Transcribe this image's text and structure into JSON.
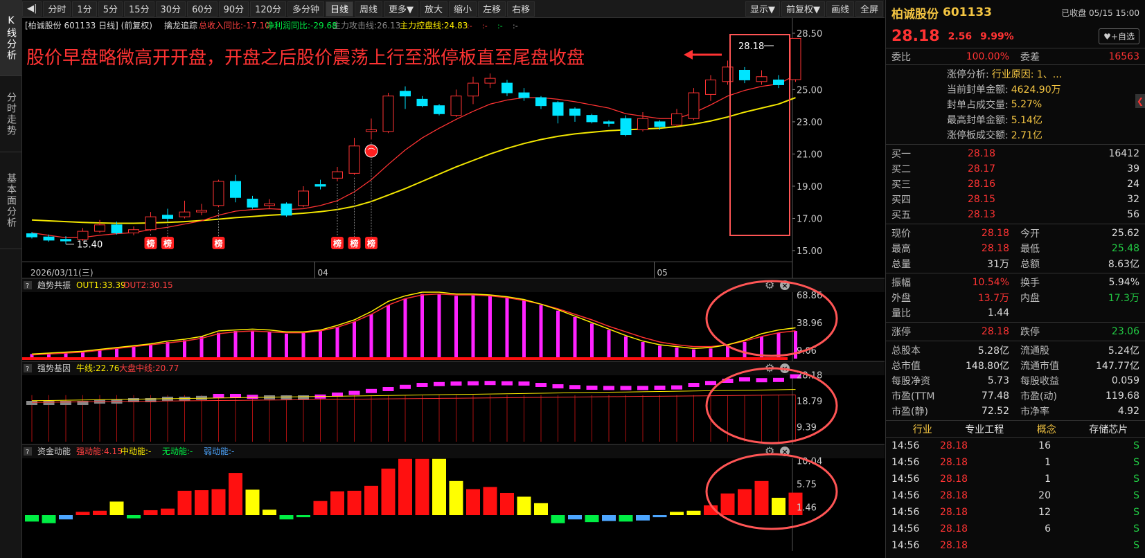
{
  "tabs": [
    "K线分析",
    "分时走势",
    "基本面分析"
  ],
  "toolbar": {
    "left": [
      "◀|",
      "分时",
      "1分",
      "5分",
      "15分",
      "30分",
      "60分",
      "90分",
      "120分",
      "多分钟",
      "日线",
      "周线",
      "更多▼",
      "放大",
      "缩小",
      "左移",
      "右移"
    ],
    "right": [
      "显示▼",
      "前复权▼",
      "画线",
      "全屏"
    ],
    "active": "日线"
  },
  "main": {
    "header": "[柏诚股份 601133 日线] (前复权)",
    "indicator": "擒龙追踪",
    "metrics": [
      "总收入同比:-17.10",
      "净利润同比:-29.68",
      "主力攻击线:26.13",
      "主力控盘线:24.83"
    ],
    "extra": [
      ":-",
      ":-",
      ":-",
      ":-"
    ],
    "annotation": "股价早盘略微高开开盘，开盘之后股价震荡上行至涨停板直至尾盘收盘",
    "price_label": "28.18",
    "low_label": "15.40",
    "date_start": "2026/03/11(三)",
    "months": [
      "04",
      "05"
    ],
    "yticks": [
      "28.50",
      "25.00",
      "23.00",
      "21.00",
      "19.00",
      "17.00",
      "15.00"
    ],
    "bang": "榜"
  },
  "ind1": {
    "name": "趋势共振",
    "out1": "OUT1:33.39",
    "out2": "OUT2:30.15",
    "yticks": [
      "68.86",
      "38.96",
      "9.06"
    ]
  },
  "ind2": {
    "name": "强势基因",
    "a": "牛线:22.76",
    "b": "大盘中线:20.77",
    "yticks": [
      "28.18",
      "18.79",
      "9.39"
    ]
  },
  "ind3": {
    "name": "资金动能",
    "a": "强动能:4.15",
    "b": "中动能:-",
    "c": "无动能:-",
    "d": "弱动能:-",
    "yticks": [
      "10.04",
      "5.75",
      "1.46"
    ]
  },
  "panel": {
    "name": "柏诚股份",
    "code": "601133",
    "status": "已收盘 05/15 15:00",
    "price": "28.18",
    "change": "2.56",
    "pct": "9.99%",
    "fav": "♥+自选",
    "weibi_l": "委比",
    "weibi": "100.00%",
    "weicha_l": "委差",
    "weicha": "16563",
    "zt": [
      {
        "l": "涨停分析:",
        "v": "行业原因: 1、..."
      },
      {
        "l": "当前封单金额:",
        "v": "4624.90万"
      },
      {
        "l": "封单占成交量:",
        "v": "5.27%"
      },
      {
        "l": "最高封单金额:",
        "v": "5.14亿"
      },
      {
        "l": "涨停板成交额:",
        "v": "2.71亿"
      }
    ],
    "bids": [
      {
        "l": "买一",
        "p": "28.18",
        "q": "16412"
      },
      {
        "l": "买二",
        "p": "28.17",
        "q": "39"
      },
      {
        "l": "买三",
        "p": "28.16",
        "q": "24"
      },
      {
        "l": "买四",
        "p": "28.15",
        "q": "32"
      },
      {
        "l": "买五",
        "p": "28.13",
        "q": "56"
      }
    ],
    "quote": [
      [
        [
          "现价",
          "28.18",
          "red"
        ],
        [
          "今开",
          "25.62",
          "white"
        ]
      ],
      [
        [
          "最高",
          "28.18",
          "red"
        ],
        [
          "最低",
          "25.48",
          "green"
        ]
      ],
      [
        [
          "总量",
          "31万",
          "white"
        ],
        [
          "总额",
          "8.63亿",
          "white"
        ]
      ]
    ],
    "quote2": [
      [
        [
          "振幅",
          "10.54%",
          "red"
        ],
        [
          "换手",
          "5.94%",
          "white"
        ]
      ],
      [
        [
          "外盘",
          "13.7万",
          "red"
        ],
        [
          "内盘",
          "17.3万",
          "green"
        ]
      ],
      [
        [
          "量比",
          "1.44",
          "white"
        ],
        [
          "",
          "",
          " white"
        ]
      ]
    ],
    "quote3": [
      [
        [
          "涨停",
          "28.18",
          "red"
        ],
        [
          "跌停",
          "23.06",
          "green"
        ]
      ]
    ],
    "fund": [
      [
        [
          "总股本",
          "5.28亿"
        ],
        [
          "流通股",
          "5.24亿"
        ]
      ],
      [
        [
          "总市值",
          "148.80亿"
        ],
        [
          "流通市值",
          "147.77亿"
        ]
      ],
      [
        [
          "每股净资",
          "5.73"
        ],
        [
          "每股收益",
          "0.059"
        ]
      ],
      [
        [
          "市盈(TTM",
          "77.48"
        ],
        [
          "市盈(动)",
          "119.68"
        ]
      ],
      [
        [
          "市盈(静)",
          "72.52"
        ],
        [
          "市净率",
          "4.92"
        ]
      ]
    ],
    "ind": [
      "行业",
      "专业工程",
      "概念",
      "存储芯片"
    ],
    "ticks": [
      {
        "t": "14:56",
        "p": "28.18",
        "v": "16",
        "s": "S"
      },
      {
        "t": "14:56",
        "p": "28.18",
        "v": "1",
        "s": "S"
      },
      {
        "t": "14:56",
        "p": "28.18",
        "v": "1",
        "s": "S"
      },
      {
        "t": "14:56",
        "p": "28.18",
        "v": "20",
        "s": "S"
      },
      {
        "t": "14:56",
        "p": "28.18",
        "v": "12",
        "s": "S"
      },
      {
        "t": "14:56",
        "p": "28.18",
        "v": "6",
        "s": "S"
      },
      {
        "t": "14:56",
        "p": "28.18",
        "v": "",
        "s": "S"
      }
    ]
  },
  "colors": {
    "up": "#ff3333",
    "down": "#00e5ff",
    "ma1": "#ff3333",
    "ma2": "#f2e600",
    "magenta": "#ff22ff",
    "yellow": "#ffff00",
    "green": "#00ee44",
    "blue": "#4da6ff",
    "ring": "#ff5555"
  },
  "chart_data": {
    "type": "candlestick",
    "ylim": [
      15.0,
      28.5
    ],
    "candles": [
      [
        16.05,
        15.85,
        16.15,
        15.75
      ],
      [
        15.85,
        15.65,
        16.0,
        15.55
      ],
      [
        15.7,
        15.6,
        15.9,
        15.4
      ],
      [
        15.7,
        16.2,
        16.4,
        15.6
      ],
      [
        16.2,
        16.6,
        16.9,
        16.1
      ],
      [
        16.6,
        16.1,
        16.8,
        16.0
      ],
      [
        16.1,
        16.3,
        16.5,
        15.95
      ],
      [
        16.3,
        17.1,
        17.4,
        16.2
      ],
      [
        17.2,
        17.0,
        17.6,
        16.8
      ],
      [
        17.1,
        17.4,
        18.1,
        17.0
      ],
      [
        17.4,
        17.5,
        17.9,
        17.2
      ],
      [
        17.8,
        19.3,
        19.4,
        17.7
      ],
      [
        19.3,
        18.3,
        19.7,
        18.0
      ],
      [
        18.2,
        17.7,
        18.4,
        17.6
      ],
      [
        17.8,
        17.9,
        18.2,
        17.6
      ],
      [
        17.9,
        17.2,
        18.0,
        17.1
      ],
      [
        17.8,
        18.7,
        19.0,
        17.7
      ],
      [
        19.1,
        19.0,
        19.4,
        18.8
      ],
      [
        19.5,
        19.9,
        20.2,
        19.3
      ],
      [
        19.8,
        21.5,
        22.0,
        19.7
      ],
      [
        22.4,
        22.5,
        23.2,
        21.9
      ],
      [
        22.4,
        24.6,
        24.8,
        22.3
      ],
      [
        24.9,
        24.6,
        25.2,
        23.8
      ],
      [
        24.4,
        24.0,
        24.6,
        23.9
      ],
      [
        24.0,
        23.5,
        24.1,
        23.4
      ],
      [
        23.4,
        24.6,
        25.0,
        23.3
      ],
      [
        24.6,
        25.4,
        25.8,
        24.1
      ],
      [
        25.4,
        25.7,
        26.0,
        25.1
      ],
      [
        25.4,
        24.8,
        25.6,
        24.6
      ],
      [
        24.8,
        24.5,
        25.1,
        24.3
      ],
      [
        24.5,
        24.0,
        24.6,
        23.8
      ],
      [
        24.2,
        23.4,
        24.3,
        22.9
      ],
      [
        23.8,
        23.4,
        23.9,
        23.0
      ],
      [
        23.4,
        23.0,
        23.5,
        22.9
      ],
      [
        23.0,
        22.9,
        23.1,
        22.7
      ],
      [
        23.2,
        22.2,
        23.4,
        22.1
      ],
      [
        22.5,
        23.2,
        23.6,
        22.4
      ],
      [
        23.0,
        22.7,
        23.1,
        22.5
      ],
      [
        22.8,
        23.5,
        23.8,
        22.7
      ],
      [
        23.2,
        24.8,
        25.1,
        23.1
      ],
      [
        24.7,
        25.6,
        25.9,
        24.3
      ],
      [
        25.5,
        26.4,
        26.8,
        25.3
      ],
      [
        26.2,
        25.6,
        26.4,
        25.4
      ],
      [
        25.5,
        25.8,
        26.2,
        25.3
      ],
      [
        25.6,
        25.3,
        25.9,
        25.1
      ],
      [
        25.62,
        28.18,
        28.18,
        25.48
      ]
    ],
    "ma_fast": [
      16.1,
      15.95,
      15.8,
      15.82,
      15.95,
      16.05,
      16.12,
      16.3,
      16.45,
      16.65,
      16.85,
      17.2,
      17.45,
      17.55,
      17.6,
      17.55,
      17.6,
      17.8,
      18.1,
      18.65,
      19.4,
      20.35,
      21.25,
      22.0,
      22.6,
      23.15,
      23.65,
      24.1,
      24.35,
      24.5,
      24.5,
      24.4,
      24.25,
      24.05,
      23.85,
      23.5,
      23.35,
      23.2,
      23.2,
      23.55,
      24.05,
      24.6,
      24.95,
      25.2,
      25.35,
      25.9
    ],
    "ma_slow": [
      16.9,
      16.85,
      16.8,
      16.75,
      16.72,
      16.7,
      16.7,
      16.72,
      16.75,
      16.8,
      16.87,
      16.95,
      17.05,
      17.12,
      17.2,
      17.25,
      17.32,
      17.42,
      17.55,
      17.75,
      18.05,
      18.45,
      18.85,
      19.3,
      19.75,
      20.2,
      20.6,
      21.0,
      21.35,
      21.65,
      21.9,
      22.1,
      22.25,
      22.35,
      22.45,
      22.5,
      22.55,
      22.6,
      22.7,
      22.85,
      23.05,
      23.3,
      23.6,
      23.85,
      24.1,
      24.5
    ],
    "ind1_bars": [
      5,
      6,
      7,
      8,
      10,
      12,
      14,
      15,
      18,
      20,
      24,
      28,
      30,
      30,
      29,
      27,
      28,
      30,
      34,
      40,
      48,
      58,
      65,
      70,
      70,
      68,
      69,
      68,
      66,
      63,
      58,
      52,
      45,
      38,
      31,
      24,
      18,
      14,
      12,
      10,
      11,
      14,
      18,
      24,
      28,
      30
    ],
    "ind1_out1": [
      5,
      6,
      7,
      8,
      10,
      12,
      14,
      16,
      19,
      21,
      24,
      30,
      31,
      32,
      31,
      29,
      29,
      31,
      36,
      42,
      51,
      62,
      68,
      72,
      72,
      70,
      70,
      69,
      67,
      64,
      59,
      53,
      46,
      39,
      32,
      25,
      19,
      15,
      13,
      11,
      12,
      15,
      20,
      27,
      31,
      33.39
    ],
    "ind1_out2": [
      4,
      5,
      6,
      7,
      9,
      11,
      13,
      15,
      17,
      19,
      22,
      27,
      29,
      30,
      29,
      28,
      28,
      30,
      34,
      40,
      48,
      58,
      65,
      69,
      70,
      69,
      69,
      68,
      66,
      63,
      59,
      54,
      48,
      42,
      35,
      29,
      23,
      18,
      15,
      13,
      13,
      15,
      19,
      24,
      28,
      30.15
    ],
    "ind2_vals": [
      18.0,
      18.0,
      18.0,
      18.0,
      18.5,
      18.5,
      19.0,
      19.0,
      19.5,
      19.5,
      19.8,
      20.5,
      20.5,
      20.2,
      20.0,
      20.0,
      20.0,
      20.3,
      21.0,
      21.6,
      22.3,
      23.0,
      23.8,
      24.5,
      24.8,
      25.0,
      25.1,
      25.2,
      25.1,
      25.0,
      24.5,
      24.0,
      23.7,
      23.5,
      23.4,
      23.4,
      23.4,
      23.5,
      23.6,
      24.5,
      25.2,
      26.0,
      26.5,
      26.2,
      26.3,
      27.6
    ],
    "ind2_pos": [
      false,
      false,
      false,
      false,
      false,
      false,
      false,
      false,
      false,
      false,
      false,
      true,
      true,
      true,
      false,
      false,
      false,
      true,
      true,
      true,
      true,
      true,
      true,
      true,
      true,
      true,
      true,
      true,
      true,
      true,
      true,
      true,
      true,
      true,
      true,
      true,
      true,
      true,
      true,
      true,
      true,
      true,
      true,
      true,
      true,
      true
    ],
    "ind3_vals": [
      1.2,
      1.5,
      0.8,
      0.6,
      0.8,
      2.5,
      0.6,
      0.9,
      1.2,
      4.5,
      4.6,
      4.8,
      7.8,
      4.7,
      1.0,
      0.8,
      0.4,
      2.6,
      4.4,
      4.5,
      5.4,
      8.6,
      10.4,
      10.4,
      10.4,
      6.3,
      4.8,
      5.2,
      4.1,
      3.4,
      2.2,
      1.5,
      0.8,
      1.3,
      1.1,
      1.2,
      1.0,
      0.4,
      0.6,
      0.8,
      1.8,
      4.0,
      4.8,
      6.3,
      3.2,
      4.15
    ],
    "ind3_cat": [
      "g",
      "g",
      "b",
      "r",
      "r",
      "y",
      "g",
      "r",
      "r",
      "r",
      "r",
      "r",
      "r",
      "y",
      "y",
      "g",
      "g",
      "r",
      "r",
      "r",
      "r",
      "r",
      "r",
      "r",
      "y",
      "y",
      "r",
      "r",
      "r",
      "y",
      "y",
      "g",
      "b",
      "g",
      "b",
      "g",
      "b",
      "b",
      "y",
      "y",
      "r",
      "r",
      "r",
      "r",
      "y",
      "r"
    ]
  }
}
